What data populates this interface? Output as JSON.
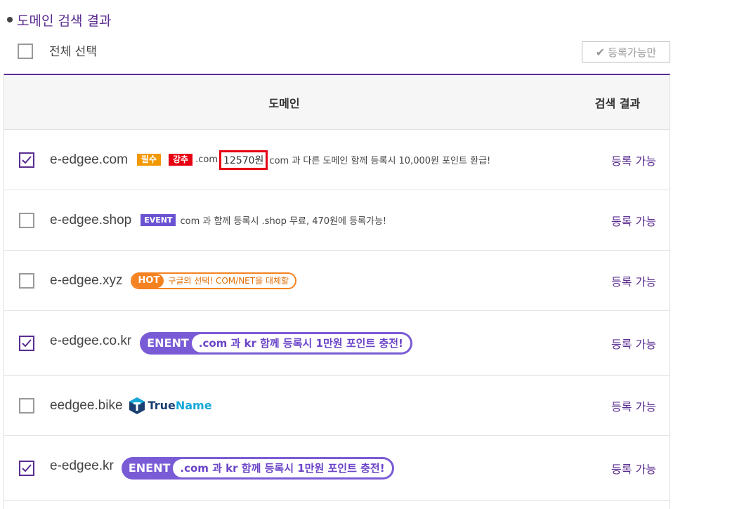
{
  "section": {
    "title": "도메인 검색 결과"
  },
  "toolbar": {
    "select_all_label": "전체 선택",
    "filter_label": "등록가능만"
  },
  "table": {
    "col_domain": "도메인",
    "col_result": "검색 결과"
  },
  "rows": [
    {
      "domain": "e-edgee.com",
      "checked": true,
      "status": "등록 가능",
      "tag1": "필수",
      "tag2": "강추",
      "pre": ".com",
      "price": "12570원",
      "promo": "com 과 다른 도메인 함께 등록시 10,000원 포인트 환급!"
    },
    {
      "domain": "e-edgee.shop",
      "checked": false,
      "status": "등록 가능",
      "tag": "EVENT",
      "promo": "com 과 함께 등록시 .shop 무료, 470원에 등록가능!"
    },
    {
      "domain": "e-edgee.xyz",
      "checked": false,
      "status": "등록 가능",
      "badge_left": "HOT",
      "badge_right": "구글의 선택! COM/NET을 대체할"
    },
    {
      "domain": "e-edgee.co.kr",
      "checked": true,
      "status": "등록 가능",
      "badge_left": "ENENT",
      "badge_right": ".com 과 kr 함께 등록시 1만원 포인트 충전!"
    },
    {
      "domain": "eedgee.bike",
      "checked": false,
      "status": "등록 가능",
      "brand_part1": "True",
      "brand_part2": "Name"
    },
    {
      "domain": "e-edgee.kr",
      "checked": true,
      "status": "등록 가능",
      "badge_left": "ENENT",
      "badge_right": ".com 과 kr 함께 등록시 1만원 포인트 충전!"
    }
  ],
  "colors": {
    "accent": "#5b2d91",
    "orange": "#f39800",
    "red": "#e60012",
    "event_purple": "#6a52d2",
    "hot_orange": "#f58220"
  }
}
